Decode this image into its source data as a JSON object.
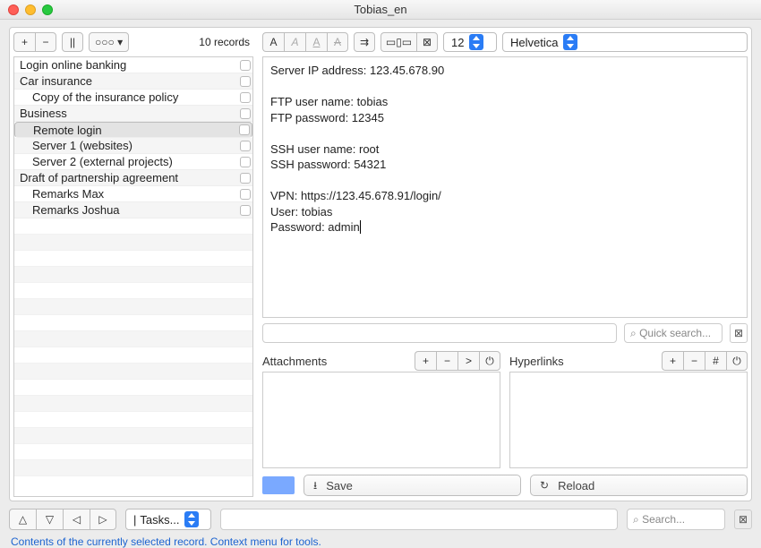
{
  "window": {
    "title": "Tobias_en"
  },
  "left_toolbar": {
    "records_label": "10 records",
    "btn_add": "+",
    "btn_remove": "−",
    "btn_pause": "||",
    "btn_more": "○○○ ▾"
  },
  "records": [
    {
      "label": "Login online banking",
      "indent": false,
      "selected": false
    },
    {
      "label": "Car insurance",
      "indent": false,
      "selected": false
    },
    {
      "label": "Copy of the insurance policy",
      "indent": true,
      "selected": false
    },
    {
      "label": "Business",
      "indent": false,
      "selected": false
    },
    {
      "label": "Remote login",
      "indent": true,
      "selected": true
    },
    {
      "label": "Server 1 (websites)",
      "indent": true,
      "selected": false
    },
    {
      "label": "Server 2 (external projects)",
      "indent": true,
      "selected": false
    },
    {
      "label": "Draft of partnership agreement",
      "indent": false,
      "selected": false
    },
    {
      "label": "Remarks Max",
      "indent": true,
      "selected": false
    },
    {
      "label": "Remarks Joshua",
      "indent": true,
      "selected": false
    }
  ],
  "right_toolbar": {
    "style_A": "A",
    "ruler_icon": "⇉",
    "gallery_icon": "▭▯▭",
    "clear_icon": "⊠",
    "font_size": "12",
    "font_name": "Helvetica"
  },
  "editor_text": "Server IP address: 123.45.678.90\n\nFTP user name: tobias\nFTP password: 12345\n\nSSH user name: root\nSSH password: 54321\n\nVPN: https://123.45.678.91/login/\nUser: tobias\nPassword: admin",
  "quick_search": {
    "placeholder": "Quick search...",
    "icon": "⌕"
  },
  "attachments": {
    "title": "Attachments",
    "btn_add": "+",
    "btn_remove": "−",
    "btn_open": ">",
    "btn_power": "⏻"
  },
  "hyperlinks": {
    "title": "Hyperlinks",
    "btn_add": "+",
    "btn_remove": "−",
    "btn_hash": "#",
    "btn_power": "⏻"
  },
  "actions": {
    "save_label": "Save",
    "save_icon": "⭳",
    "reload_label": "Reload",
    "reload_icon": "↻"
  },
  "footer": {
    "nav_up": "△",
    "nav_down": "▽",
    "nav_left": "◁",
    "nav_right": "▷",
    "tasks_label": "Tasks...",
    "search_placeholder": "Search...",
    "search_icon": "⌕",
    "clear_icon": "⊠"
  },
  "hint": "Contents of the currently selected record. Context menu for tools."
}
